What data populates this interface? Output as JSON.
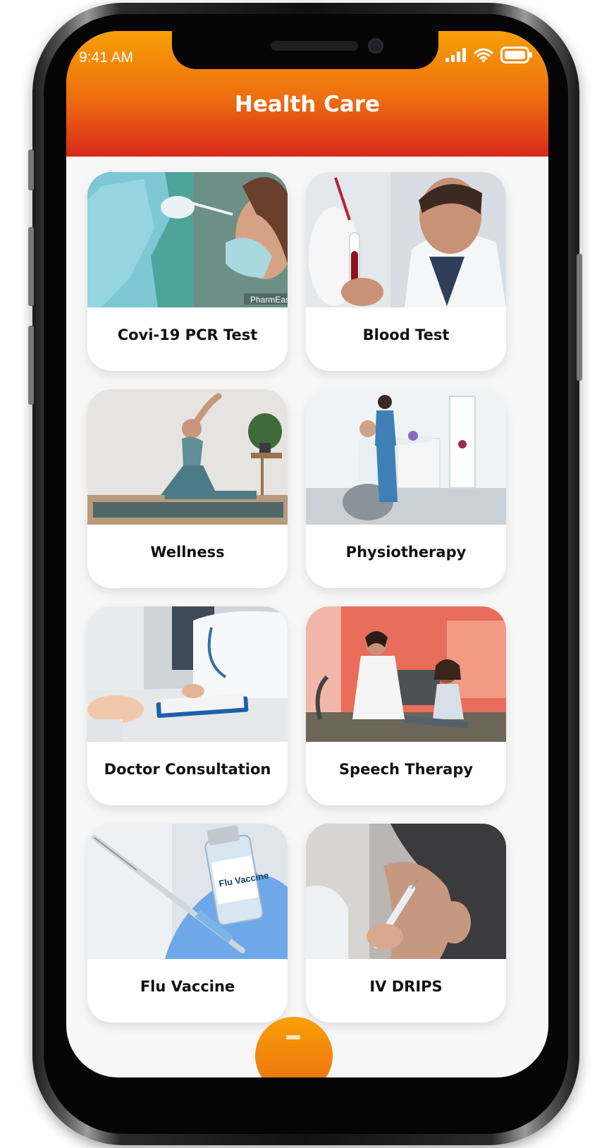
{
  "status_bar": {
    "time": "9:41 AM"
  },
  "header": {
    "title": "Health Care"
  },
  "colors": {
    "header_top": "#f7a006",
    "header_bottom": "#d8281c",
    "background": "#f7f7f7"
  },
  "services": [
    {
      "label": "Covi-19 PCR Test",
      "image": "nasal-swab-photo",
      "watermark": "PharmEasy"
    },
    {
      "label": "Blood Test",
      "image": "lab-blood-sample-photo"
    },
    {
      "label": "Wellness",
      "image": "yoga-stretch-photo"
    },
    {
      "label": "Physiotherapy",
      "image": "physio-exercise-ball-photo"
    },
    {
      "label": "Doctor Consultation",
      "image": "doctor-desk-photo"
    },
    {
      "label": "Speech Therapy",
      "image": "child-therapy-photo"
    },
    {
      "label": "Flu Vaccine",
      "image": "flu-vaccine-vial-photo",
      "vial_text": "Flu Vaccine"
    },
    {
      "label": "IV DRIPS",
      "image": "arm-injection-photo"
    }
  ],
  "icons": {
    "signal": "signal-icon",
    "wifi": "wifi-icon",
    "battery": "battery-icon",
    "fab": "home-icon"
  }
}
